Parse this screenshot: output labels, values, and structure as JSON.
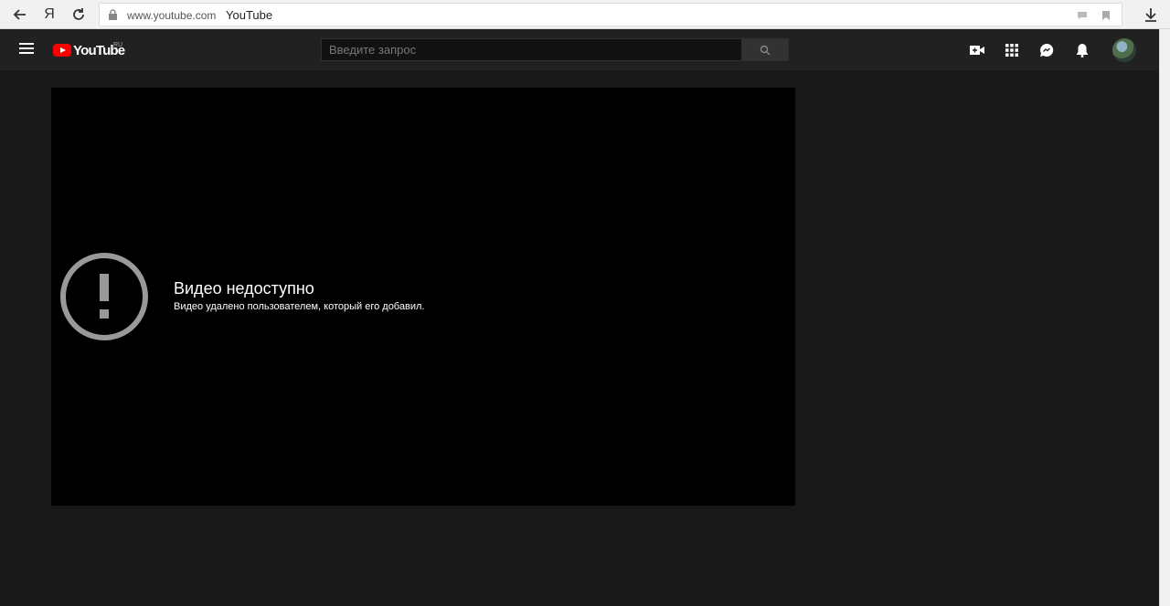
{
  "browser": {
    "back_icon": "arrow-left-icon",
    "yandex_label": "Я",
    "reload_icon": "reload-icon",
    "url": "www.youtube.com",
    "page_title": "YouTube"
  },
  "header": {
    "logo_text": "YouTube",
    "logo_region": "RU",
    "search_placeholder": "Введите запрос",
    "icons": [
      "video-camera-icon",
      "apps-grid-icon",
      "messages-icon",
      "notifications-bell-icon"
    ]
  },
  "player": {
    "error_title": "Видео недоступно",
    "error_subtitle": "Видео удалено пользователем, который его добавил."
  },
  "colors": {
    "brand": "#ff0000",
    "page_bg": "#181818",
    "header_bg": "#212121"
  }
}
